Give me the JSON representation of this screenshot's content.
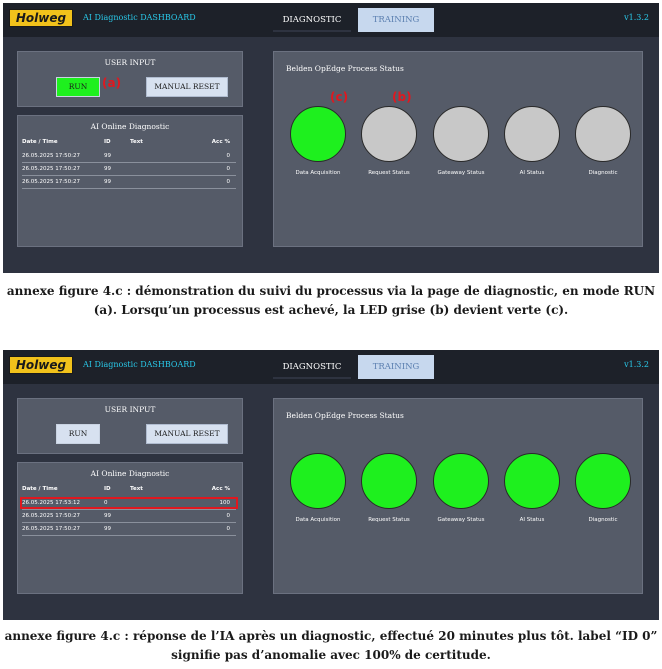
{
  "app": {
    "logo": "Holweg",
    "title": "AI Diagnostic DASHBOARD",
    "version": "v1.3.2",
    "tabs": [
      "DIAGNOSTIC",
      "TRAINING"
    ]
  },
  "user_input": {
    "title": "USER INPUT",
    "run_label": "RUN",
    "reset_label": "MANUAL RESET"
  },
  "ai_diag": {
    "title": "AI Online Diagnostic",
    "columns": [
      "Date / Time",
      "ID",
      "Text",
      "Acc %"
    ]
  },
  "status": {
    "title": "Belden OpEdge Process Status",
    "leds": [
      "Data Acquisition",
      "Request Status",
      "Gateaway Status",
      "AI Status",
      "Diagnostic"
    ]
  },
  "colors": {
    "led_on": "#1ef01e",
    "led_off": "#c8c8c8",
    "run_active": "#1ef01e",
    "run_idle": "#d7e1f0",
    "annotation": "#e0181f"
  },
  "screens": [
    {
      "run_active": true,
      "led_states": [
        "on",
        "off",
        "off",
        "off",
        "off"
      ],
      "annotations": {
        "run": "(a)",
        "led_green": "(c)",
        "led_grey": "(b)"
      },
      "rows": [
        {
          "date": "26.05.2025 17:50:27",
          "id": "99",
          "text": "",
          "acc": "0"
        },
        {
          "date": "26.05.2025 17:50:27",
          "id": "99",
          "text": "",
          "acc": "0"
        },
        {
          "date": "26.05.2025 17:50:27",
          "id": "99",
          "text": "",
          "acc": "0"
        }
      ],
      "caption": "annexe figure 4.c : démonstration du suivi du processus via la page de diagnostic, en mode RUN (a). Lorsqu’un processus est achevé, la LED grise (b) devient verte (c)."
    },
    {
      "run_active": false,
      "led_states": [
        "on",
        "on",
        "on",
        "on",
        "on"
      ],
      "highlighted_row": 0,
      "rows": [
        {
          "date": "26.05.2025 17:53:12",
          "id": "0",
          "text": "",
          "acc": "100"
        },
        {
          "date": "26.05.2025 17:50:27",
          "id": "99",
          "text": "",
          "acc": "0"
        },
        {
          "date": "26.05.2025 17:50:27",
          "id": "99",
          "text": "",
          "acc": "0"
        }
      ],
      "caption": "annexe figure 4.c : réponse de l’IA après un diagnostic, effectué 20 minutes plus tôt. label “ID 0” signifie pas d’anomalie avec 100% de certitude."
    }
  ]
}
